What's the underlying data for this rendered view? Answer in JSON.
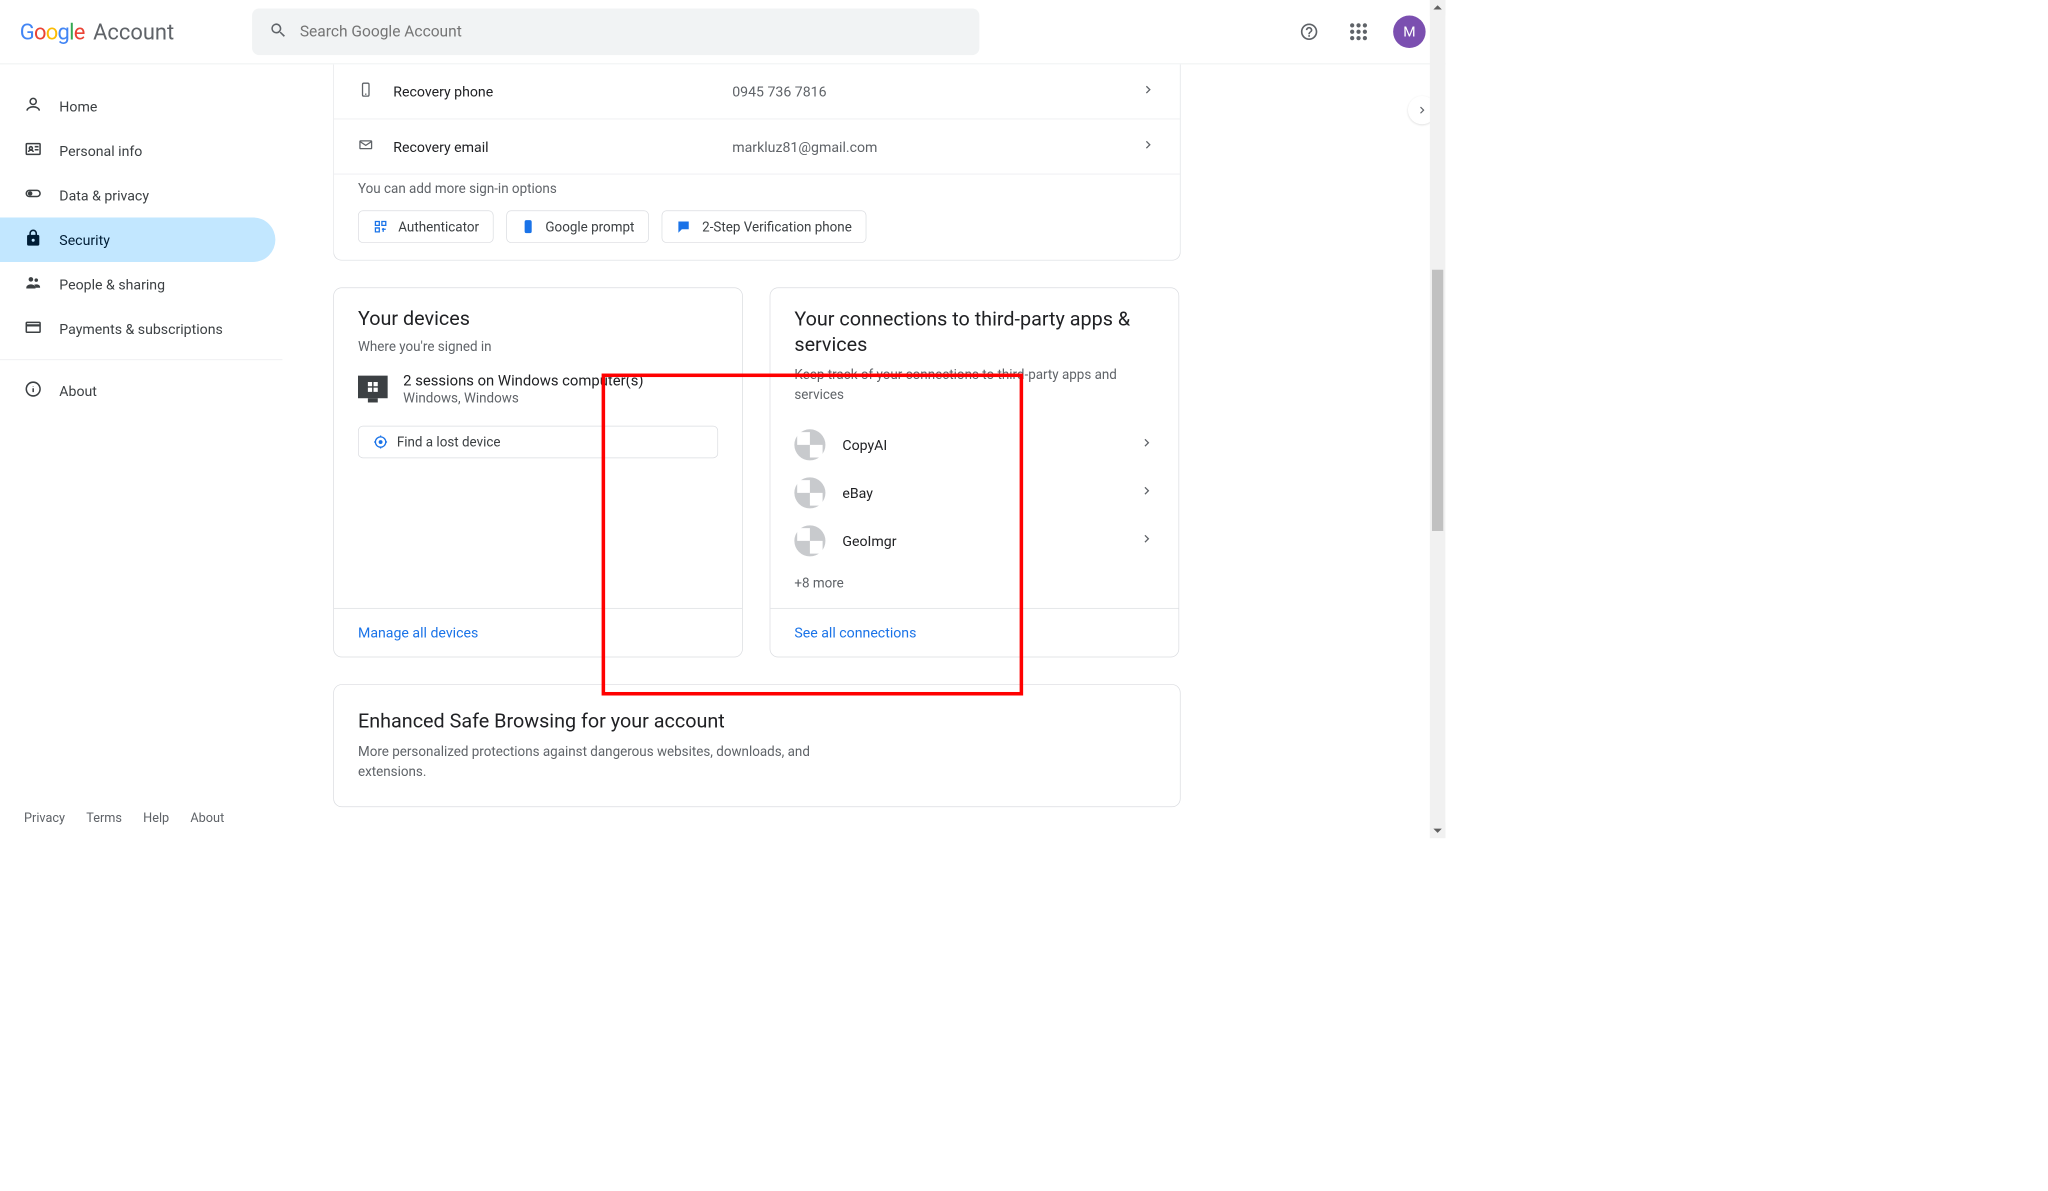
{
  "header": {
    "logo_account": "Account",
    "search_placeholder": "Search Google Account",
    "avatar_letter": "M"
  },
  "sidebar": {
    "items": [
      {
        "label": "Home"
      },
      {
        "label": "Personal info"
      },
      {
        "label": "Data & privacy"
      },
      {
        "label": "Security"
      },
      {
        "label": "People & sharing"
      },
      {
        "label": "Payments & subscriptions"
      }
    ],
    "about": "About"
  },
  "footer": {
    "privacy": "Privacy",
    "terms": "Terms",
    "help": "Help",
    "about": "About"
  },
  "recovery": {
    "phone_label": "Recovery phone",
    "phone_value": "0945 736 7816",
    "email_label": "Recovery email",
    "email_value": "markluz81@gmail.com",
    "note": "You can add more sign-in options",
    "chips": [
      "Authenticator",
      "Google prompt",
      "2-Step Verification phone"
    ]
  },
  "devices": {
    "title": "Your devices",
    "subtitle": "Where you're signed in",
    "session_title": "2 sessions on Windows computer(s)",
    "session_sub": "Windows, Windows",
    "find": "Find a lost device",
    "manage": "Manage all devices"
  },
  "connections": {
    "title": "Your connections to third-party apps & services",
    "subtitle": "Keep track of your connections to third-party apps and services",
    "apps": [
      "CopyAI",
      "eBay",
      "GeoImgr"
    ],
    "more": "+8 more",
    "seeall": "See all connections"
  },
  "esb": {
    "title": "Enhanced Safe Browsing for your account",
    "desc": "More personalized protections against dangerous websites, downloads, and extensions."
  }
}
